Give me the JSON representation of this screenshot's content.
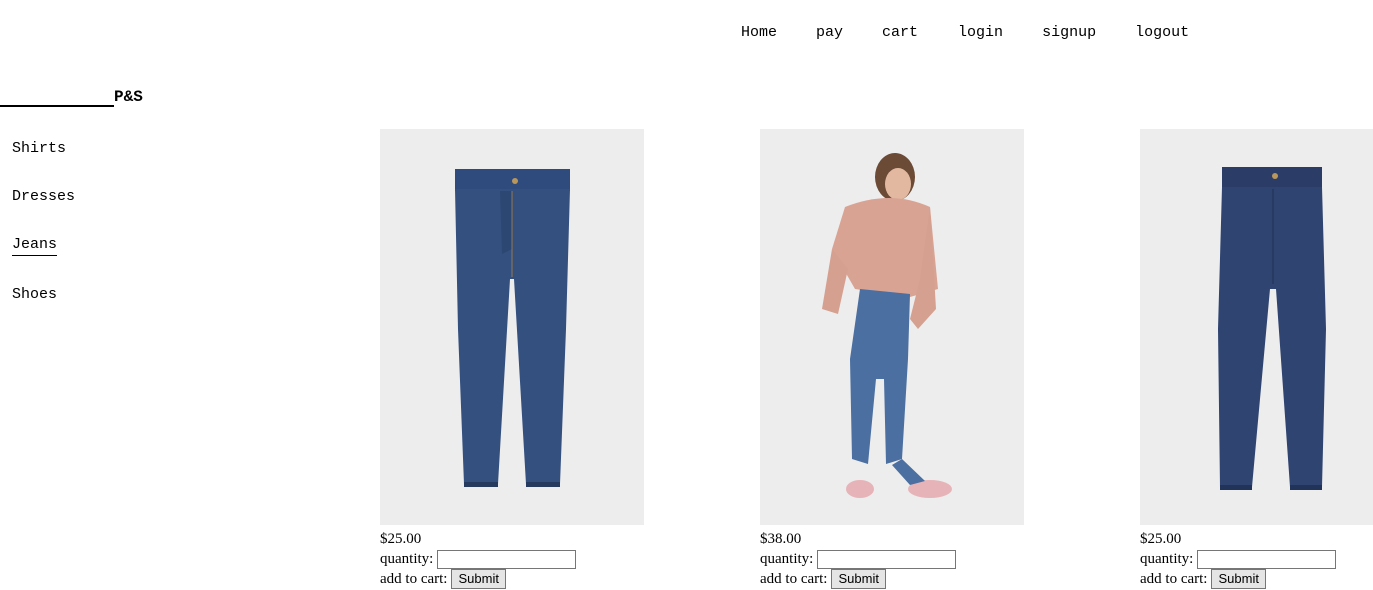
{
  "nav": {
    "items": [
      "Home",
      "pay",
      "cart",
      "login",
      "signup",
      "logout"
    ]
  },
  "brand": {
    "name": "P&S"
  },
  "sidebar": {
    "items": [
      {
        "label": "Shirts",
        "active": false
      },
      {
        "label": "Dresses",
        "active": false
      },
      {
        "label": "Jeans",
        "active": true
      },
      {
        "label": "Shoes",
        "active": false
      }
    ]
  },
  "products": [
    {
      "image": "jeans-product-photo",
      "price": "$25.00",
      "quantity_label": "quantity:",
      "quantity_value": "",
      "cart_label": "add to cart:",
      "submit_label": "Submit"
    },
    {
      "image": "model-wearing-jeans-photo",
      "price": "$38.00",
      "quantity_label": "quantity:",
      "quantity_value": "",
      "cart_label": "add to cart:",
      "submit_label": "Submit"
    },
    {
      "image": "jeans-product-photo",
      "price": "$25.00",
      "quantity_label": "quantity:",
      "quantity_value": "",
      "cart_label": "add to cart:",
      "submit_label": "Submit"
    }
  ],
  "colors": {
    "photo_bg": "#ededed",
    "denim_dark": "#2b3d66",
    "denim_mid": "#3e5f8e",
    "hoodie": "#d9a394",
    "sneaker": "#e6b3b8"
  }
}
